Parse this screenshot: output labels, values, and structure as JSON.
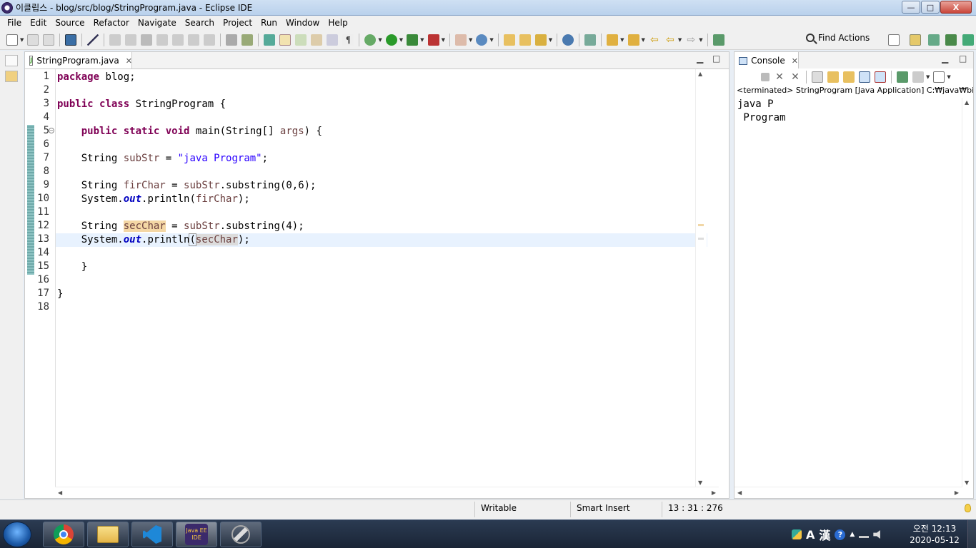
{
  "window": {
    "title": "이클립스 - blog/src/blog/StringProgram.java - Eclipse IDE",
    "controls": {
      "minimize": "—",
      "maximize": "□",
      "close": "X"
    }
  },
  "menu": [
    "File",
    "Edit",
    "Source",
    "Refactor",
    "Navigate",
    "Search",
    "Project",
    "Run",
    "Window",
    "Help"
  ],
  "toolbar": {
    "find_actions": "Find Actions"
  },
  "editor": {
    "tab_label": "StringProgram.java",
    "tab_close": "✕",
    "file_icon_letter": "J",
    "line_numbers": [
      "1",
      "2",
      "3",
      "4",
      "5",
      "6",
      "7",
      "8",
      "9",
      "10",
      "11",
      "12",
      "13",
      "14",
      "15",
      "16",
      "17",
      "18"
    ],
    "lines": {
      "l1_kw": "package",
      "l1_rest": " blog;",
      "l3_kw1": "public",
      "l3_kw2": "class",
      "l3_rest": " StringProgram {",
      "l5_kw1": "public",
      "l5_kw2": "static",
      "l5_kw3": "void",
      "l5_mid": " main(String[] ",
      "l5_var": "args",
      "l5_end": ") {",
      "l7_type": "String ",
      "l7_var": "subStr",
      "l7_eq": " = ",
      "l7_str": "\"java Program\"",
      "l7_end": ";",
      "l9_type": "String ",
      "l9_var": "firChar",
      "l9_eq": " = ",
      "l9_var2": "subStr",
      "l9_end": ".substring(0,6);",
      "l10_a": "System.",
      "l10_fld": "out",
      "l10_b": ".println(",
      "l10_var": "firChar",
      "l10_end": ");",
      "l12_type": "String ",
      "l12_var": "secChar",
      "l12_eq": " = ",
      "l12_var2": "subStr",
      "l12_end": ".substring(4);",
      "l13_a": "System.",
      "l13_fld": "out",
      "l13_b": ".println",
      "l13_paren": "(",
      "l13_var": "secChar",
      "l13_end": ");",
      "l15": "}",
      "l17": "}"
    }
  },
  "console": {
    "tab_label": "Console",
    "tab_close": "✕",
    "status": "<terminated> StringProgram [Java Application] C:₩java₩bin₩",
    "output": [
      "java P",
      " Program"
    ]
  },
  "statusbar": {
    "writable": "Writable",
    "insert_mode": "Smart Insert",
    "position": "13 : 31 : 276"
  },
  "taskbar": {
    "eclipse_label": "Java EE IDE",
    "tray_lang": "A",
    "tray_hanja": "漢",
    "clock_time": "오전 12:13",
    "clock_date": "2020-05-12"
  }
}
